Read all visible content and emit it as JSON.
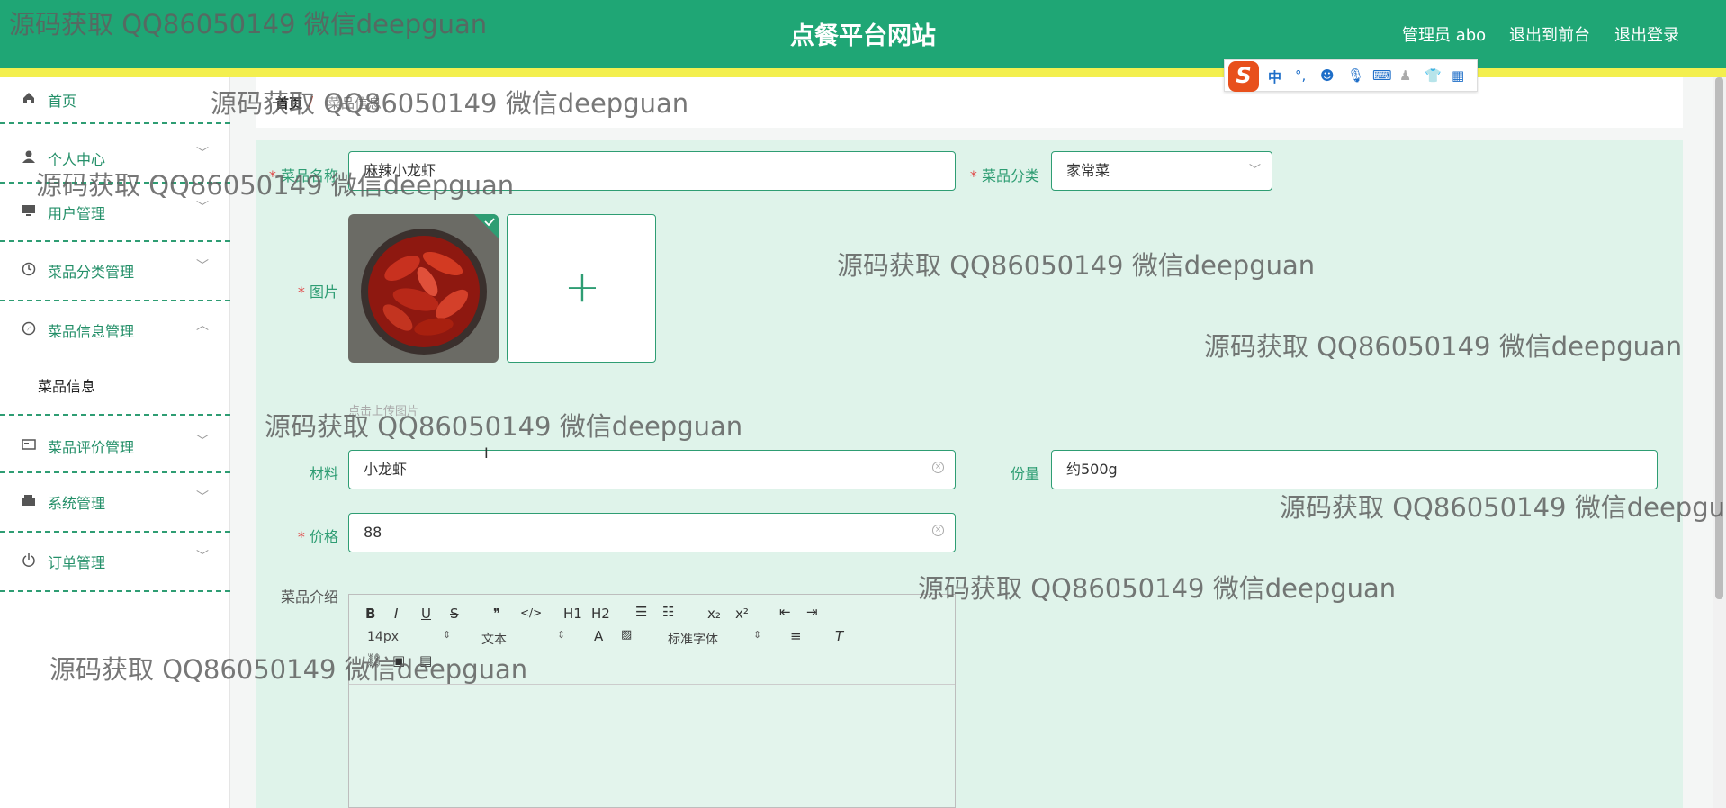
{
  "header": {
    "title": "点餐平台网站",
    "admin": "管理员 abo",
    "to_front": "退出到前台",
    "logout": "退出登录"
  },
  "sidebar": {
    "items": [
      {
        "label": "首页",
        "icon": "home-icon"
      },
      {
        "label": "个人中心",
        "icon": "user-icon"
      },
      {
        "label": "用户管理",
        "icon": "monitor-icon"
      },
      {
        "label": "菜品分类管理",
        "icon": "clock-icon"
      },
      {
        "label": "菜品信息管理",
        "icon": "compass-icon"
      },
      {
        "label": "菜品评价管理",
        "icon": "card-icon"
      },
      {
        "label": "系统管理",
        "icon": "wallet-icon"
      },
      {
        "label": "订单管理",
        "icon": "power-icon"
      }
    ],
    "sub_item": "菜品信息"
  },
  "breadcrumb": {
    "home": "首页",
    "separator": "/",
    "current": "菜品信息"
  },
  "form": {
    "name_label": "菜品名称",
    "name_value": "麻辣小龙虾",
    "category_label": "菜品分类",
    "category_value": "家常菜",
    "image_label": "图片",
    "upload_hint": "点击上传图片",
    "material_label": "材料",
    "material_value": "小龙虾",
    "portion_label": "份量",
    "portion_value": "约500g",
    "price_label": "价格",
    "price_value": "88",
    "intro_label": "菜品介绍",
    "required_mark": "*"
  },
  "editor": {
    "size": "14px",
    "format": "文本",
    "font": "标准字体",
    "buttons": [
      "B",
      "I",
      "U",
      "S",
      "❞",
      "</>",
      "H1",
      "H2",
      "x₂",
      "x²"
    ]
  },
  "watermark": "源码获取 QQ86050149 微信deepguan",
  "colors": {
    "primary": "#1fa675",
    "accent": "#f3ef4e",
    "form_bg": "#dff3ea"
  }
}
